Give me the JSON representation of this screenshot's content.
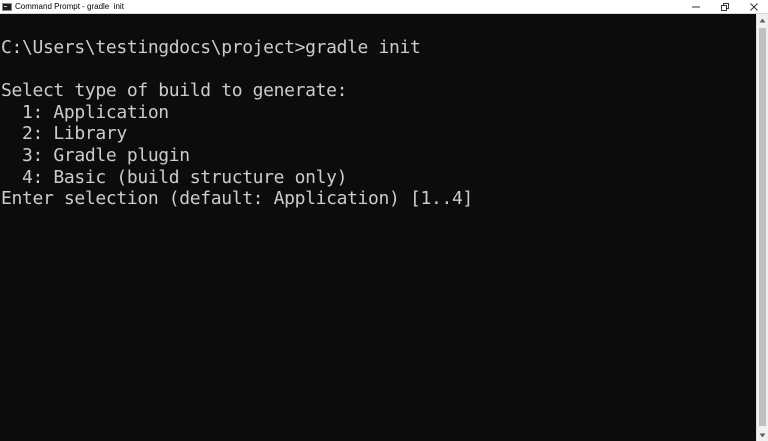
{
  "window": {
    "title": "Command Prompt - gradle  init",
    "icon": "cmd-icon"
  },
  "controls": {
    "minimize": "minimize-icon",
    "restore": "restore-icon",
    "close": "close-icon"
  },
  "console": {
    "lines": [
      "C:\\Users\\testingdocs\\project>gradle init",
      "",
      "Select type of build to generate:",
      "  1: Application",
      "  2: Library",
      "  3: Gradle plugin",
      "  4: Basic (build structure only)",
      "Enter selection (default: Application) [1..4]"
    ]
  },
  "colors": {
    "console_bg": "#0c0c0c",
    "console_fg": "#cccccc",
    "titlebar_bg": "#ffffff"
  }
}
